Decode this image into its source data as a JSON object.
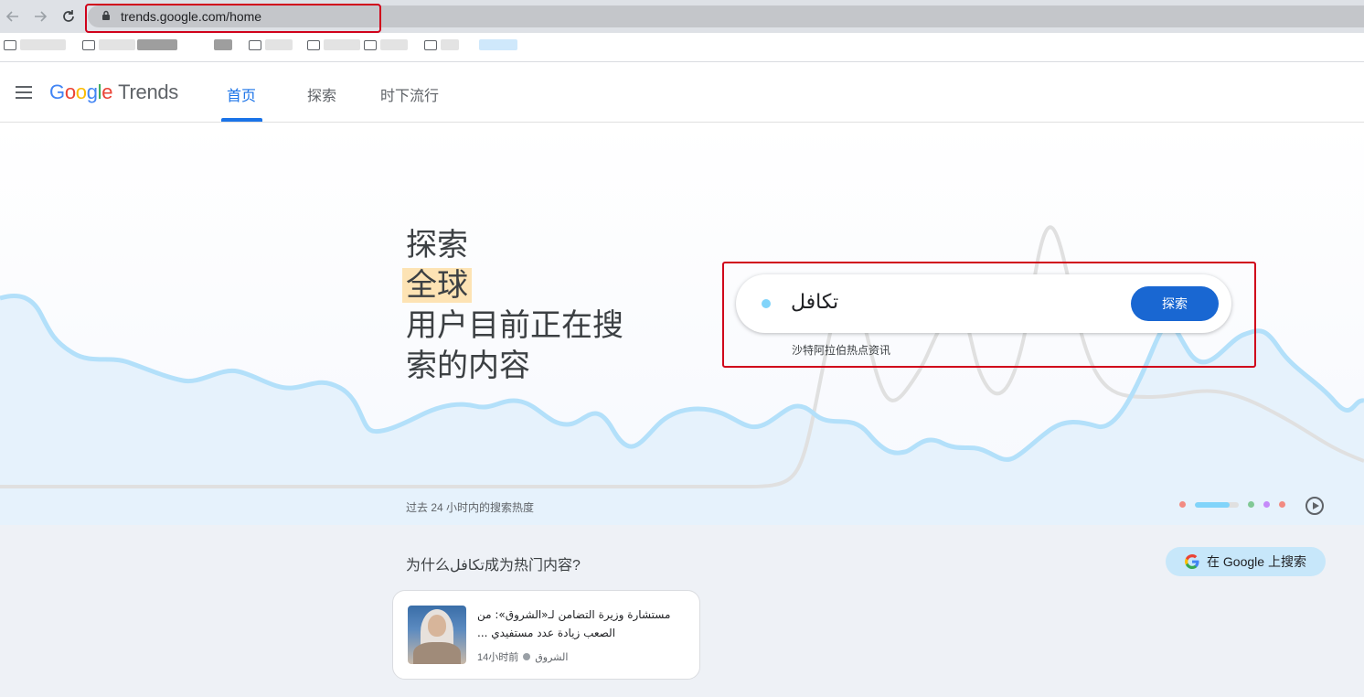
{
  "browser": {
    "url": "trends.google.com/home",
    "bookmarks": [
      "",
      "",
      "",
      "",
      "",
      "",
      ""
    ]
  },
  "header": {
    "logo_letters": [
      "G",
      "o",
      "o",
      "g",
      "l",
      "e"
    ],
    "logo_suffix": "Trends",
    "tabs": [
      {
        "label": "首页",
        "active": true
      },
      {
        "label": "探索",
        "active": false
      },
      {
        "label": "时下流行",
        "active": false
      }
    ]
  },
  "hero": {
    "title_lines": [
      "探索",
      "全球",
      "用户目前正在搜",
      "索的内容"
    ],
    "search_term": "تكافل",
    "search_button": "探索",
    "search_sub": "沙特阿拉伯热点资讯",
    "caption": "过去 24 小时内的搜索热度",
    "carousel_dot_colors": [
      "#f28b82",
      "#81c995",
      "#c58af9",
      "#f28b82"
    ],
    "progress_fraction": 0.8
  },
  "lower": {
    "why_title": "为什么تكافل成为热门内容?",
    "google_search_label": "在 Google 上搜索",
    "news": {
      "headline": "مستشارة وزيرة التضامن لـ«الشروق»: من الصعب زيادة عدد مستفيدي ...",
      "time": "14小时前",
      "source": "الشروق"
    }
  },
  "colors": {
    "accent": "#1a73e8",
    "search_button": "#1967d2",
    "highlight": "#d0021b",
    "title_highlight": "#fde3b4"
  }
}
